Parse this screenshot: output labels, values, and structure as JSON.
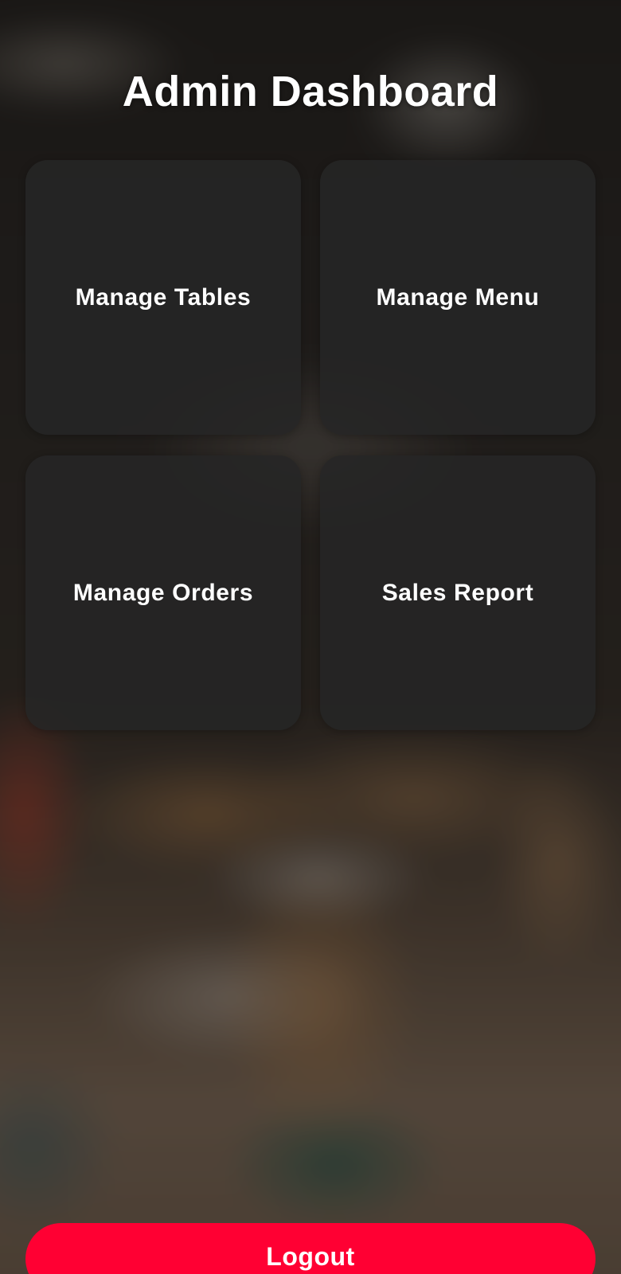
{
  "header": {
    "title": "Admin Dashboard"
  },
  "tiles": [
    {
      "label": "Manage Tables"
    },
    {
      "label": "Manage Menu"
    },
    {
      "label": "Manage Orders"
    },
    {
      "label": "Sales Report"
    }
  ],
  "footer": {
    "logout_label": "Logout"
  },
  "colors": {
    "accent": "#ff0033",
    "tile_bg": "#262626",
    "text": "#ffffff"
  }
}
